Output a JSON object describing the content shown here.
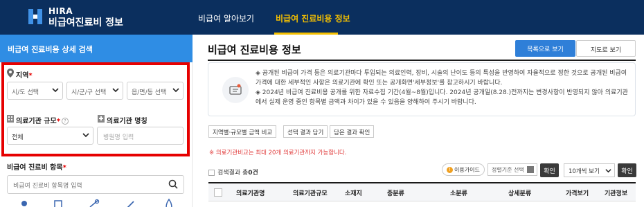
{
  "header": {
    "logo_line1": "HIRA",
    "logo_line2": "비급여진료비 정보",
    "nav": [
      "비급여 알아보기",
      "비급여 진료비용 정보"
    ],
    "bg_color": "#0b2f5e",
    "active_color": "#f5c000"
  },
  "sidebar": {
    "title": "비급여 진료비용 상세 검색",
    "region_label": "지역",
    "region_selects": [
      "시/도 선택",
      "시/군/구 선택",
      "읍/면/동 선택"
    ],
    "scale_label": "의료기관 규모",
    "scale_value": "전체",
    "name_label": "의료기관 명칭",
    "name_placeholder": "병원명 입력",
    "item_label": "비급여 진료비 항목",
    "item_placeholder": "비급여 진료비 항목명 입력",
    "required_mark": "*",
    "help_mark": "?",
    "category_icons": [
      "person-icon",
      "document-icon",
      "syringe-icon",
      "tool-icon",
      "hand-icon"
    ]
  },
  "main": {
    "title": "비급여 진료비용 정보",
    "btn_list": "목록으로 보기",
    "btn_map": "지도로 보기",
    "notice_line1": "◈ 공개된 비급여 가격 등은 의료기관마다 투입되는 의료인력, 장비, 시술의 난이도 등의 특성을 반영하여 자율적으로 정한 것으로 공개된 비급여 가격에 대한 세부적인 사항은 의료기관에 확인 또는 공개화면'세부정보'를 참고하시기 바랍니다.",
    "notice_line2": "◈ 2024년 비급여 진료비용 공개를 위한 자료수집 기간(4월~8월)입니다. 2024년 공개일(8.28.)전까지는 변경사항이 반영되지 않아 의료기관에서 실제 운영 중인 항목별 금액과 차이가 있을 수 있음을 양해하여 주시기 바랍니다.",
    "chips": [
      "지역별·규모별 금액 비교",
      "선택 결과 담기",
      "담은 결과 확인"
    ],
    "warning": "※ 의료기관비교는 최대 20개 의료기관까지 가능합니다.",
    "result_prefix": "검색결과 총",
    "result_count": "0건",
    "guide_mark": "!",
    "guide_label": "이용가이드",
    "sort_label": "정렬기준 선택",
    "confirm": "확인",
    "count_select": "10개씩 보기",
    "columns": [
      "의료기관명",
      "의료기관규모",
      "소재지",
      "중분류",
      "소분류",
      "상세분류",
      "가격보기",
      "기관정보"
    ]
  }
}
